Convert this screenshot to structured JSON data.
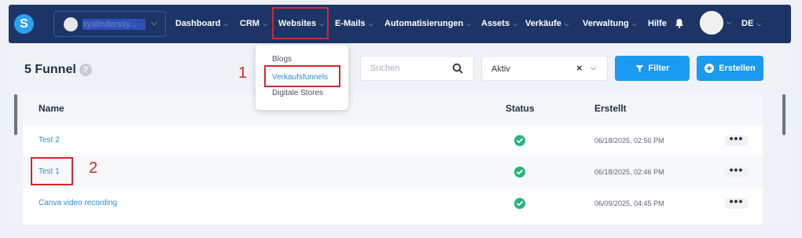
{
  "nav": {
    "account_name": "xyalinderssy...",
    "items": [
      {
        "label": "Dashboard",
        "has_chevron": true
      },
      {
        "label": "CRM",
        "has_chevron": true
      },
      {
        "label": "Websites",
        "has_chevron": true
      },
      {
        "label": "E-Mails",
        "has_chevron": true
      },
      {
        "label": "Automatisierungen",
        "has_chevron": true
      },
      {
        "label": "Assets",
        "has_chevron": true
      },
      {
        "label": "Verkäufe",
        "has_chevron": true
      },
      {
        "label": "Verwaltung",
        "has_chevron": true
      },
      {
        "label": "Hilfe",
        "has_chevron": false
      }
    ],
    "language": "DE"
  },
  "page": {
    "title": "5 Funnel",
    "help_icon": "question-mark-icon",
    "search_placeholder": "Suchen",
    "status_filter": "Aktiv",
    "filter_button": "Filter",
    "create_button": "Erstellen"
  },
  "dropdown": {
    "items": [
      "Blogs",
      "Verkaufsfunnels",
      "Digitale Stores"
    ],
    "active_index": 1
  },
  "table": {
    "columns": [
      "Name",
      "Status",
      "Erstellt"
    ],
    "rows": [
      {
        "name": "Test 2",
        "status": "check",
        "created": "06/18/2025, 02:50 PM"
      },
      {
        "name": "Test 1",
        "status": "check",
        "created": "06/18/2025, 02:46 PM"
      },
      {
        "name": "Canva video recording",
        "status": "check",
        "created": "06/09/2025, 04:45 PM"
      }
    ]
  },
  "annotations": [
    "1",
    "2"
  ],
  "colors": {
    "nav_bg": "#1c3566",
    "accent": "#1a9af0",
    "link": "#2a8fd8",
    "status_ok": "#27b57b",
    "highlight": "#d9262c"
  }
}
